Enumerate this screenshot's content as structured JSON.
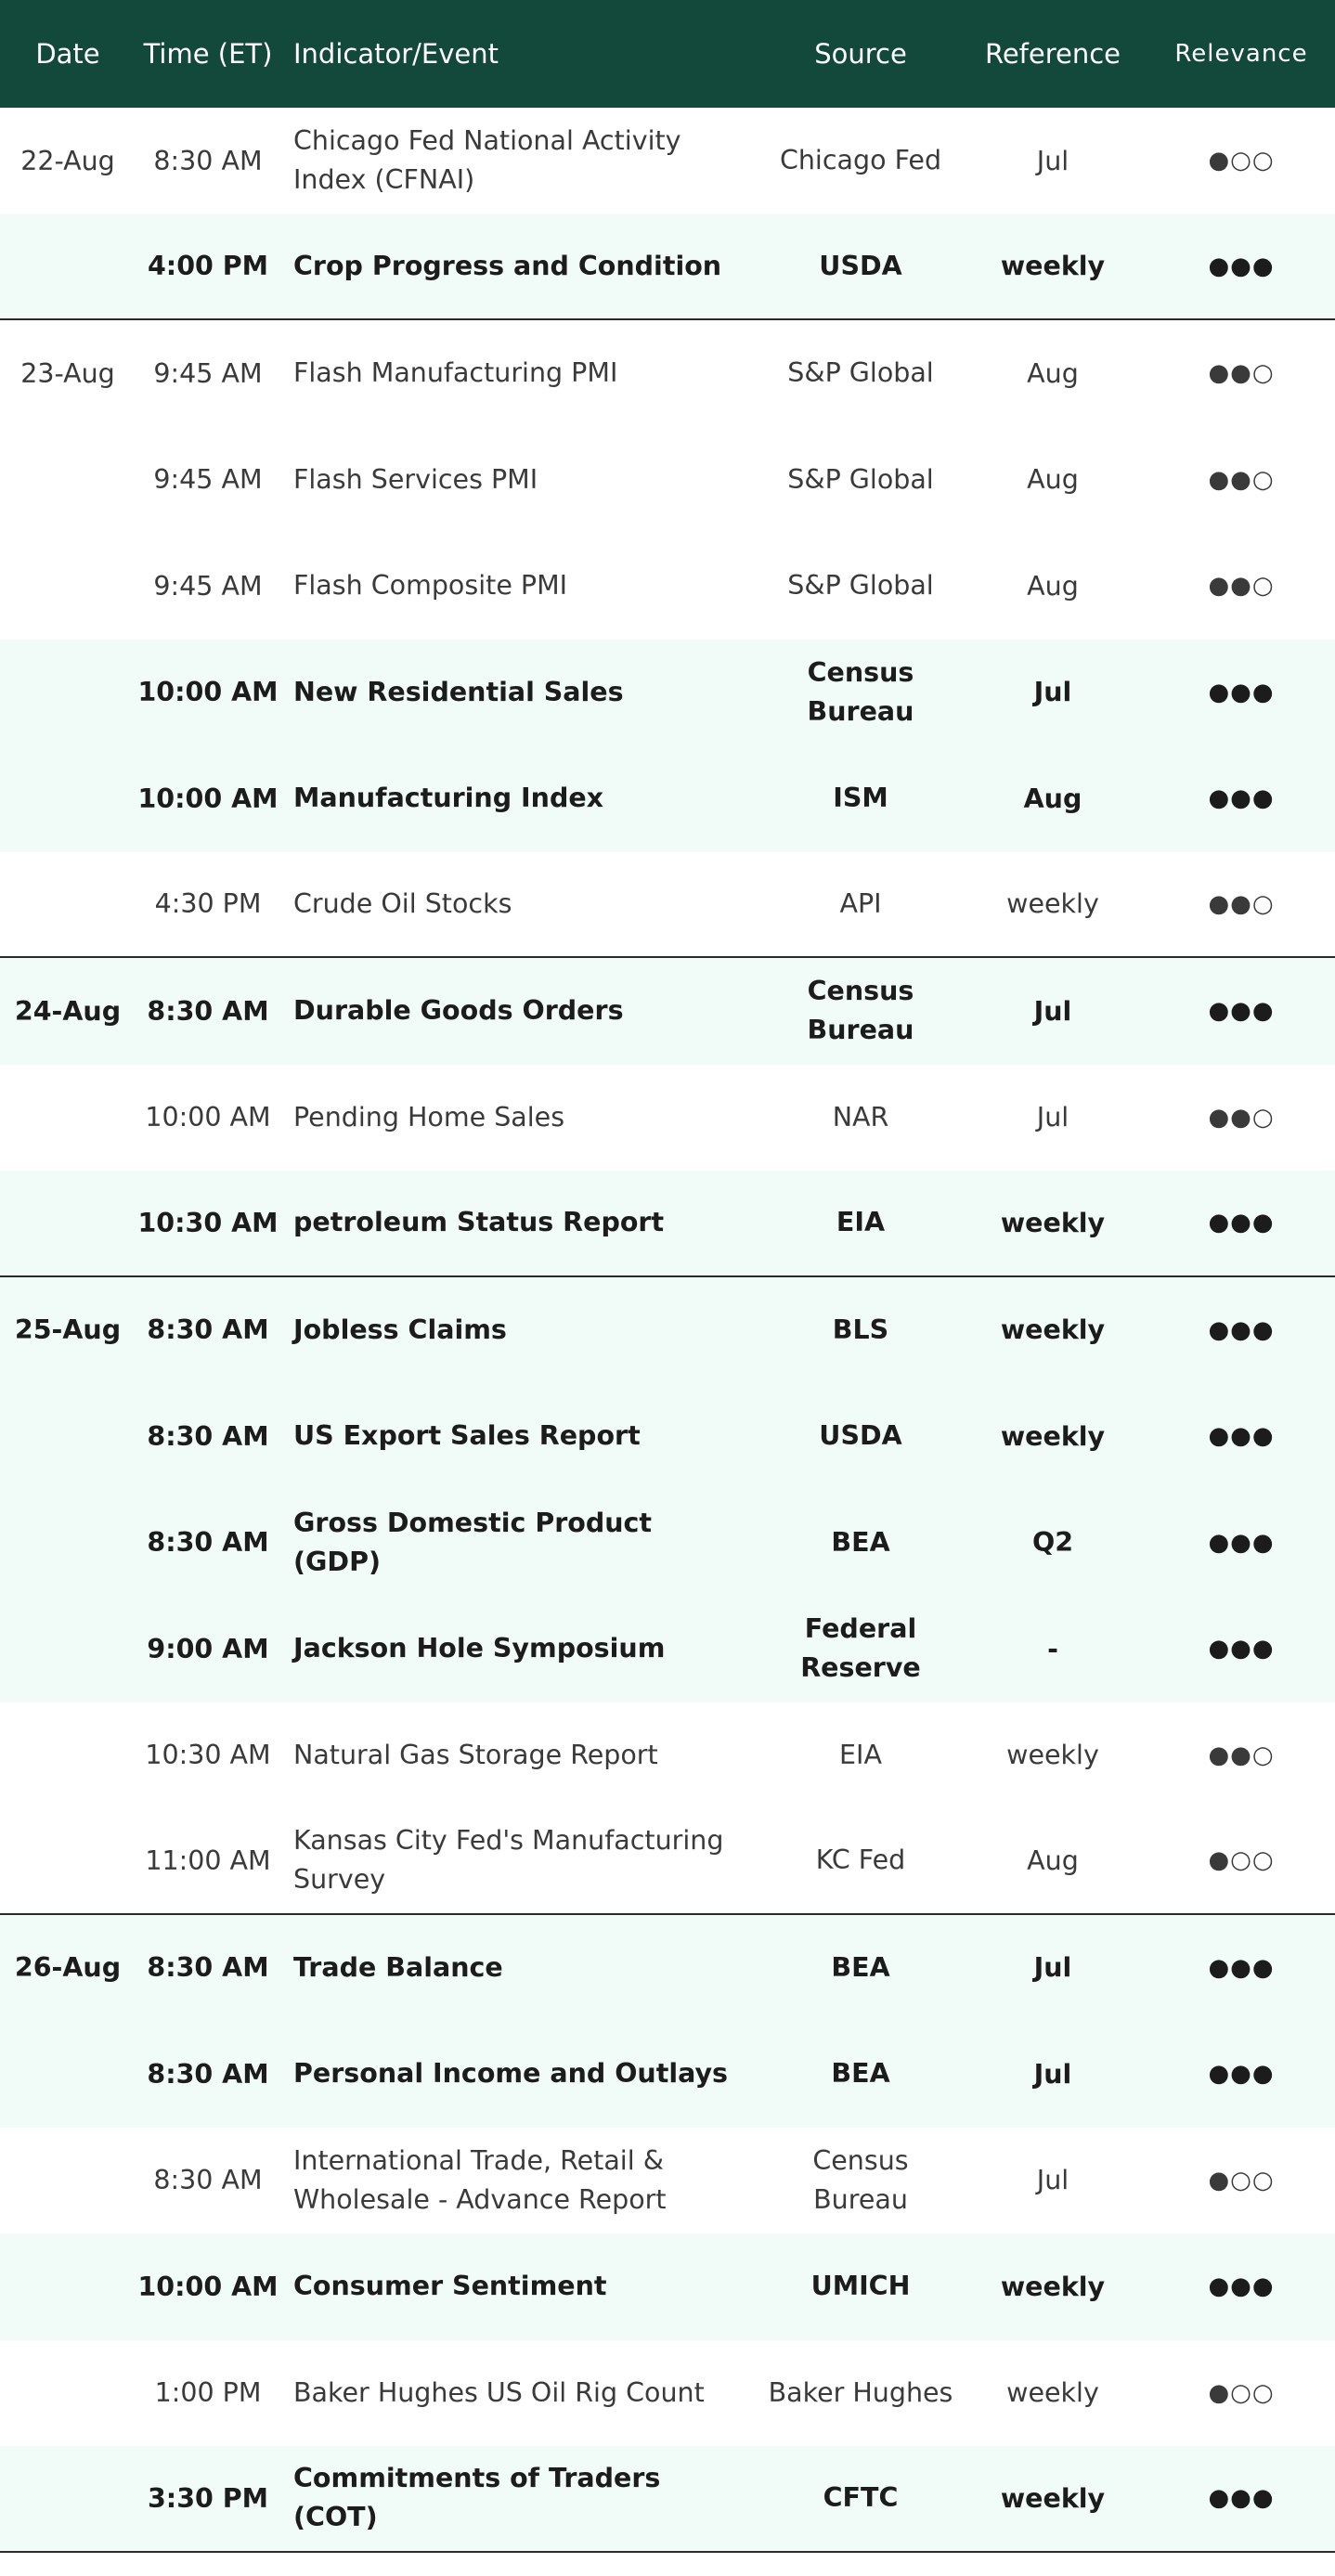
{
  "columns": {
    "date": "Date",
    "time": "Time (ET)",
    "indicator": "Indicator/Event",
    "source": "Source",
    "reference": "Reference",
    "relevance": "Relevance"
  },
  "rows": [
    {
      "date": "22-Aug",
      "time": "8:30 AM",
      "indicator": "Chicago Fed National Activity Index (CFNAI)",
      "source": "Chicago Fed",
      "reference": "Jul",
      "relevance": "●○○",
      "bold": false,
      "group_end": false
    },
    {
      "date": "",
      "time": "4:00 PM",
      "indicator": "Crop Progress and Condition",
      "source": "USDA",
      "reference": "weekly",
      "relevance": "●●●",
      "bold": true,
      "group_end": true
    },
    {
      "date": "23-Aug",
      "time": "9:45 AM",
      "indicator": "Flash Manufacturing PMI",
      "source": "S&P Global",
      "reference": "Aug",
      "relevance": "●●○",
      "bold": false,
      "group_end": false
    },
    {
      "date": "",
      "time": "9:45 AM",
      "indicator": "Flash Services PMI",
      "source": "S&P Global",
      "reference": "Aug",
      "relevance": "●●○",
      "bold": false,
      "group_end": false
    },
    {
      "date": "",
      "time": "9:45 AM",
      "indicator": "Flash Composite PMI",
      "source": "S&P Global",
      "reference": "Aug",
      "relevance": "●●○",
      "bold": false,
      "group_end": false
    },
    {
      "date": "",
      "time": "10:00 AM",
      "indicator": "New Residential Sales",
      "source": "Census Bureau",
      "reference": "Jul",
      "relevance": "●●●",
      "bold": true,
      "group_end": false
    },
    {
      "date": "",
      "time": "10:00 AM",
      "indicator": "Manufacturing Index",
      "source": "ISM",
      "reference": "Aug",
      "relevance": "●●●",
      "bold": true,
      "group_end": false
    },
    {
      "date": "",
      "time": "4:30 PM",
      "indicator": "Crude Oil Stocks",
      "source": "API",
      "reference": "weekly",
      "relevance": "●●○",
      "bold": false,
      "group_end": true
    },
    {
      "date": "24-Aug",
      "time": "8:30 AM",
      "indicator": "Durable Goods Orders",
      "source": "Census Bureau",
      "reference": "Jul",
      "relevance": "●●●",
      "bold": true,
      "group_end": false
    },
    {
      "date": "",
      "time": "10:00 AM",
      "indicator": "Pending Home Sales",
      "source": "NAR",
      "reference": "Jul",
      "relevance": "●●○",
      "bold": false,
      "group_end": false
    },
    {
      "date": "",
      "time": "10:30 AM",
      "indicator": "petroleum Status Report",
      "source": "EIA",
      "reference": "weekly",
      "relevance": "●●●",
      "bold": true,
      "group_end": true
    },
    {
      "date": "25-Aug",
      "time": "8:30 AM",
      "indicator": "Jobless Claims",
      "source": "BLS",
      "reference": "weekly",
      "relevance": "●●●",
      "bold": true,
      "group_end": false
    },
    {
      "date": "",
      "time": "8:30 AM",
      "indicator": "US Export Sales Report",
      "source": "USDA",
      "reference": "weekly",
      "relevance": "●●●",
      "bold": true,
      "group_end": false
    },
    {
      "date": "",
      "time": "8:30 AM",
      "indicator": "Gross Domestic Product (GDP)",
      "source": "BEA",
      "reference": "Q2",
      "relevance": "●●●",
      "bold": true,
      "group_end": false
    },
    {
      "date": "",
      "time": "9:00 AM",
      "indicator": "Jackson Hole Symposium",
      "source": "Federal Reserve",
      "reference": "-",
      "relevance": "●●●",
      "bold": true,
      "group_end": false
    },
    {
      "date": "",
      "time": "10:30 AM",
      "indicator": "Natural Gas Storage Report",
      "source": "EIA",
      "reference": "weekly",
      "relevance": "●●○",
      "bold": false,
      "group_end": false
    },
    {
      "date": "",
      "time": "11:00 AM",
      "indicator": "Kansas City Fed's Manufacturing Survey",
      "source": "KC Fed",
      "reference": "Aug",
      "relevance": "●○○",
      "bold": false,
      "group_end": true
    },
    {
      "date": "26-Aug",
      "time": "8:30 AM",
      "indicator": "Trade Balance",
      "source": "BEA",
      "reference": "Jul",
      "relevance": "●●●",
      "bold": true,
      "group_end": false
    },
    {
      "date": "",
      "time": "8:30 AM",
      "indicator": "Personal Income and Outlays",
      "source": "BEA",
      "reference": "Jul",
      "relevance": "●●●",
      "bold": true,
      "group_end": false
    },
    {
      "date": "",
      "time": "8:30 AM",
      "indicator": "International Trade, Retail & Wholesale - Advance Report",
      "source": "Census Bureau",
      "reference": "Jul",
      "relevance": "●○○",
      "bold": false,
      "group_end": false
    },
    {
      "date": "",
      "time": "10:00 AM",
      "indicator": "Consumer Sentiment",
      "source": "UMICH",
      "reference": "weekly",
      "relevance": "●●●",
      "bold": true,
      "group_end": false
    },
    {
      "date": "",
      "time": "1:00 PM",
      "indicator": "Baker Hughes US Oil Rig Count",
      "source": "Baker Hughes",
      "reference": "weekly",
      "relevance": "●○○",
      "bold": false,
      "group_end": false
    },
    {
      "date": "",
      "time": "3:30 PM",
      "indicator": "Commitments of Traders (COT)",
      "source": "CFTC",
      "reference": "weekly",
      "relevance": "●●●",
      "bold": true,
      "group_end": true
    }
  ]
}
